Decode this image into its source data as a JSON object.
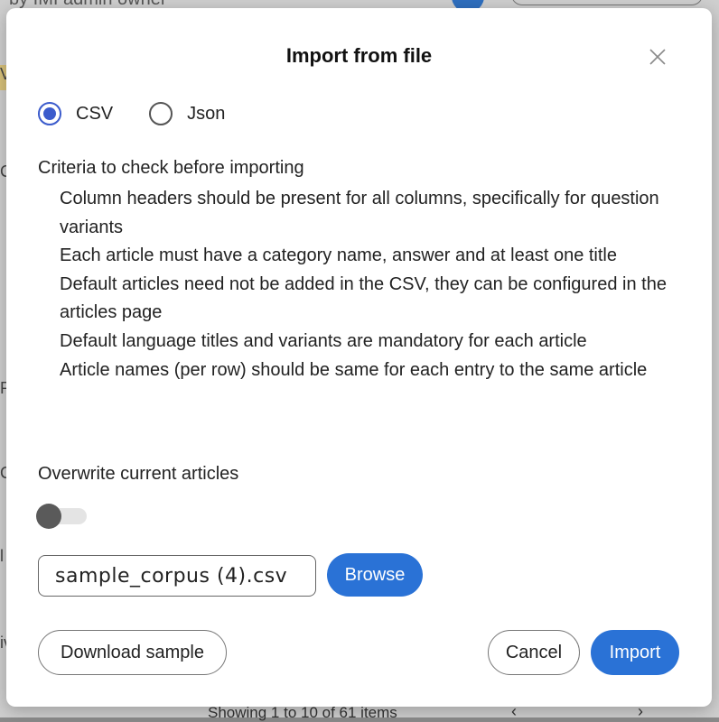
{
  "background": {
    "top_text": "by IMI admin owner",
    "left_letters": [
      "V",
      "C",
      "P",
      "C",
      "l",
      "iv"
    ],
    "pagination_text": "Showing 1 to 10 of 61 items"
  },
  "dialog": {
    "title": "Import from file",
    "format": {
      "selected": "CSV",
      "options": [
        {
          "label": "CSV",
          "checked": true
        },
        {
          "label": "Json",
          "checked": false
        }
      ]
    },
    "criteria": {
      "heading": "Criteria to check before importing",
      "items": [
        "Column headers should be present for all columns, specifically for question variants",
        "Each article must have a category name, answer and at least one title",
        "Default articles need not be added in the CSV, they can be configured in the articles page",
        "Default language titles and variants are mandatory for each article",
        "Article names (per row) should be same for each entry to the same article"
      ]
    },
    "overwrite": {
      "label": "Overwrite current articles",
      "enabled": false
    },
    "file": {
      "name": "sample_corpus (4).csv",
      "browse_label": "Browse"
    },
    "actions": {
      "download_label": "Download sample",
      "cancel_label": "Cancel",
      "import_label": "Import"
    },
    "colors": {
      "primary": "#2a72d6",
      "radio_accent": "#3b5bcc"
    }
  }
}
